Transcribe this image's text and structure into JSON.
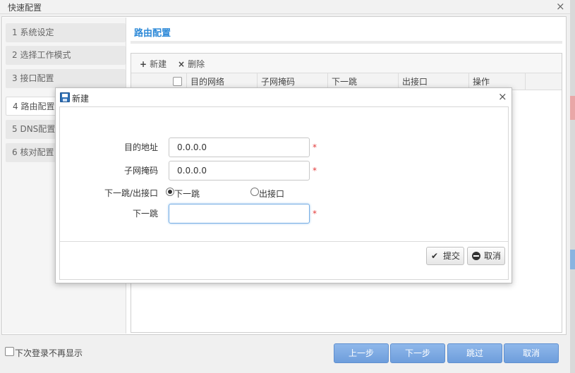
{
  "window": {
    "title": "快速配置",
    "close_glyph": "×"
  },
  "steps": [
    {
      "label": "1 系统设定"
    },
    {
      "label": "2 选择工作模式"
    },
    {
      "label": "3 接口配置"
    },
    {
      "label": "4 路由配置"
    },
    {
      "label": "5 DNS配置"
    },
    {
      "label": "6 核对配置"
    }
  ],
  "content": {
    "title": "路由配置",
    "toolbar": {
      "new_label": "新建",
      "delete_label": "删除"
    },
    "columns": [
      "目的网络",
      "子网掩码",
      "下一跳",
      "出接口",
      "操作"
    ]
  },
  "footer": {
    "no_remind_label": "下次登录不再显示",
    "prev_label": "上一步",
    "next_label": "下一步",
    "skip_label": "跳过",
    "cancel_label": "取消"
  },
  "dialog": {
    "title": "新建",
    "fields": {
      "dest_label": "目的地址",
      "dest_value": "0.0.0.0",
      "mask_label": "子网掩码",
      "mask_value": "0.0.0.0",
      "type_label": "下一跳/出接口",
      "opt_nexthop": "下一跳",
      "opt_iface": "出接口",
      "nexthop_label": "下一跳",
      "nexthop_value": ""
    },
    "required_mark": "*",
    "submit_label": "提交",
    "cancel_label": "取消"
  },
  "colors": {
    "accent": "#2e8ad8",
    "nav_button": "#7aa8e2",
    "required": "#e23b3b"
  },
  "icons": [
    "save-icon",
    "plus-icon",
    "delete-x-icon",
    "checkmark-icon",
    "cancel-circle-icon"
  ]
}
